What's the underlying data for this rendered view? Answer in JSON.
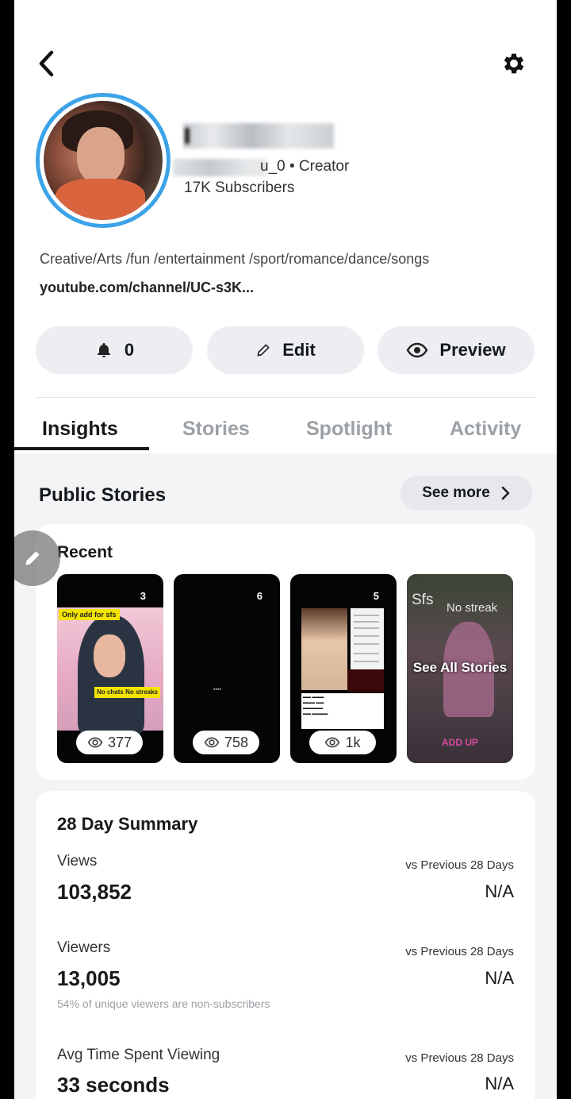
{
  "header": {
    "back_icon": "chevron-left-icon",
    "settings_icon": "gear-icon"
  },
  "profile": {
    "handle_suffix": "u_0 • Creator",
    "subscribers": "17K Subscribers",
    "bio": "Creative/Arts /fun /entertainment /sport/romance/dance/songs",
    "link": "youtube.com/channel/UC-s3K..."
  },
  "actions": {
    "bell_count": "0",
    "edit_label": "Edit",
    "preview_label": "Preview"
  },
  "tabs": [
    {
      "label": "Insights",
      "active": true
    },
    {
      "label": "Stories",
      "active": false
    },
    {
      "label": "Spotlight",
      "active": false
    },
    {
      "label": "Activity",
      "active": false
    }
  ],
  "public_stories": {
    "title": "Public Stories",
    "see_more": "See more",
    "recent_title": "Recent",
    "stories": [
      {
        "number": "3",
        "views": "377",
        "banner": "Only add for sfs",
        "tag": "No chats No streaks"
      },
      {
        "number": "6",
        "views": "758"
      },
      {
        "number": "5",
        "views": "1k"
      },
      {
        "sfs": "Sfs",
        "no_streak": "No streak",
        "see_all": "See All Stories",
        "add_up": "ADD UP"
      }
    ]
  },
  "summary": {
    "title": "28 Day Summary",
    "compare_label": "vs Previous 28 Days",
    "metrics": [
      {
        "label": "Views",
        "value": "103,852",
        "compare": "N/A"
      },
      {
        "label": "Viewers",
        "value": "13,005",
        "compare": "N/A",
        "note": "54% of unique viewers are non-subscribers"
      },
      {
        "label": "Avg Time Spent Viewing",
        "value": "33 seconds",
        "compare": "N/A"
      }
    ]
  },
  "colors": {
    "avatar_ring": "#3ca3e8",
    "pill_bg": "#eceef1",
    "page_gray": "#f3f4f6",
    "inactive_tab": "#9ca1a6"
  }
}
